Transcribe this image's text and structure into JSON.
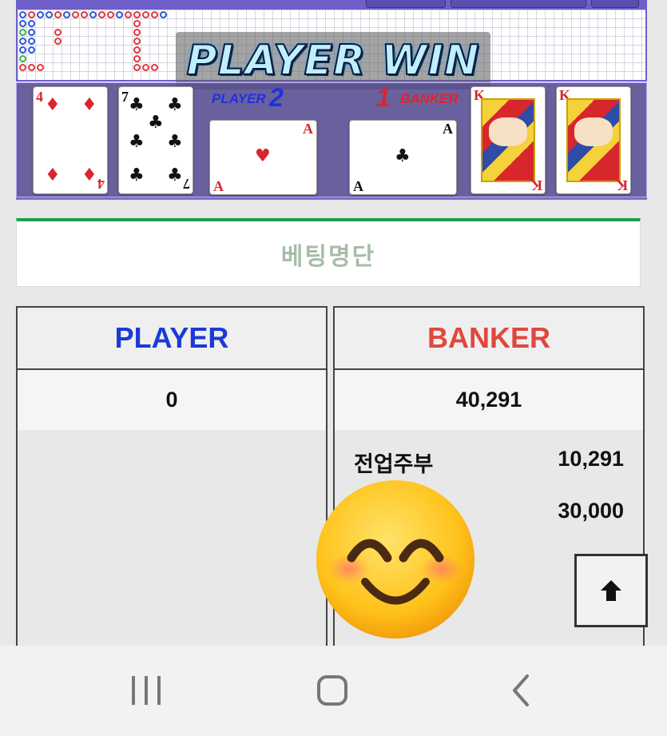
{
  "game": {
    "result_banner": "PLAYER WIN",
    "player": {
      "label": "PLAYER",
      "score": "2"
    },
    "banker": {
      "label": "BANKER",
      "score": "1"
    },
    "player_cards": [
      {
        "rank": "4",
        "suit": "♦",
        "color": "red"
      },
      {
        "rank": "7",
        "suit": "♣",
        "color": "black"
      },
      {
        "rank": "A",
        "suit": "♥",
        "color": "red"
      }
    ],
    "banker_cards": [
      {
        "rank": "A",
        "suit": "♣",
        "color": "black"
      },
      {
        "rank": "K",
        "suit": "♥",
        "color": "red"
      },
      {
        "rank": "K",
        "suit": "♥",
        "color": "red"
      }
    ]
  },
  "betlist": {
    "title": "베팅명단"
  },
  "table": {
    "player": {
      "header": "PLAYER",
      "total": "0",
      "header_color": "#1a3bd6",
      "bets": []
    },
    "banker": {
      "header": "BANKER",
      "total": "40,291",
      "header_color": "#e0473f",
      "bets": [
        {
          "name": "전업주부",
          "amount": "10,291"
        },
        {
          "name": "",
          "amount": "30,000"
        }
      ]
    }
  },
  "scroll_top": {
    "icon": "arrow-up-icon"
  },
  "overlay": {
    "icon": "smiling-face-emoji-icon"
  },
  "navbar": {
    "recent": "recent-apps-icon",
    "home": "home-icon",
    "back": "back-icon"
  }
}
